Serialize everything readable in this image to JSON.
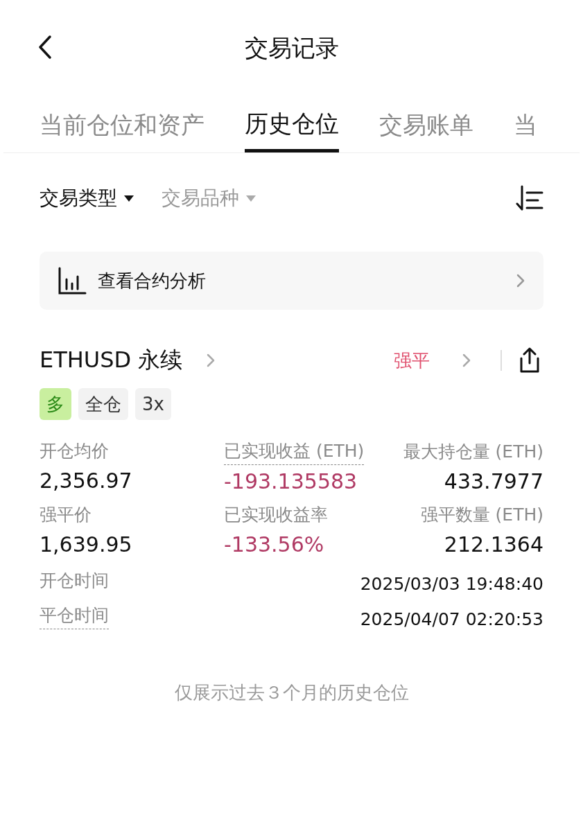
{
  "header": {
    "title": "交易记录"
  },
  "tabs": [
    {
      "label": "当前仓位和资产",
      "selected": false
    },
    {
      "label": "历史仓位",
      "selected": true
    },
    {
      "label": "交易账单",
      "selected": false
    },
    {
      "label": "当",
      "selected": false
    }
  ],
  "filters": [
    {
      "label": "交易类型",
      "selected": true
    },
    {
      "label": "交易品种",
      "selected": false
    }
  ],
  "analysis": {
    "label": "查看合约分析"
  },
  "position": {
    "symbol": "ETHUSD 永续",
    "status": "强平",
    "tags": [
      {
        "label": "多",
        "kind": "long"
      },
      {
        "label": "全仓",
        "kind": "plain"
      },
      {
        "label": "3x",
        "kind": "plain"
      }
    ],
    "metrics": [
      {
        "label": "开仓均价",
        "value": "2,356.97",
        "negative": false,
        "dashed_underline": false
      },
      {
        "label": "已实现收益 (ETH)",
        "value": "-193.135583",
        "negative": true,
        "dashed_underline": true
      },
      {
        "label": "最大持仓量 (ETH)",
        "value": "433.7977",
        "negative": false,
        "dashed_underline": false
      },
      {
        "label": "强平价",
        "value": "1,639.95",
        "negative": false,
        "dashed_underline": false
      },
      {
        "label": "已实现收益率",
        "value": "-133.56%",
        "negative": true,
        "dashed_underline": false
      },
      {
        "label": "强平数量 (ETH)",
        "value": "212.1364",
        "negative": false,
        "dashed_underline": false
      }
    ],
    "times": [
      {
        "label": "开仓时间",
        "value": "2025/03/03 19:48:40",
        "dashed_underline": false
      },
      {
        "label": "平仓时间",
        "value": "2025/04/07 02:20:53",
        "dashed_underline": true
      }
    ]
  },
  "footer_note": "仅展示过去３个月的历史仓位"
}
